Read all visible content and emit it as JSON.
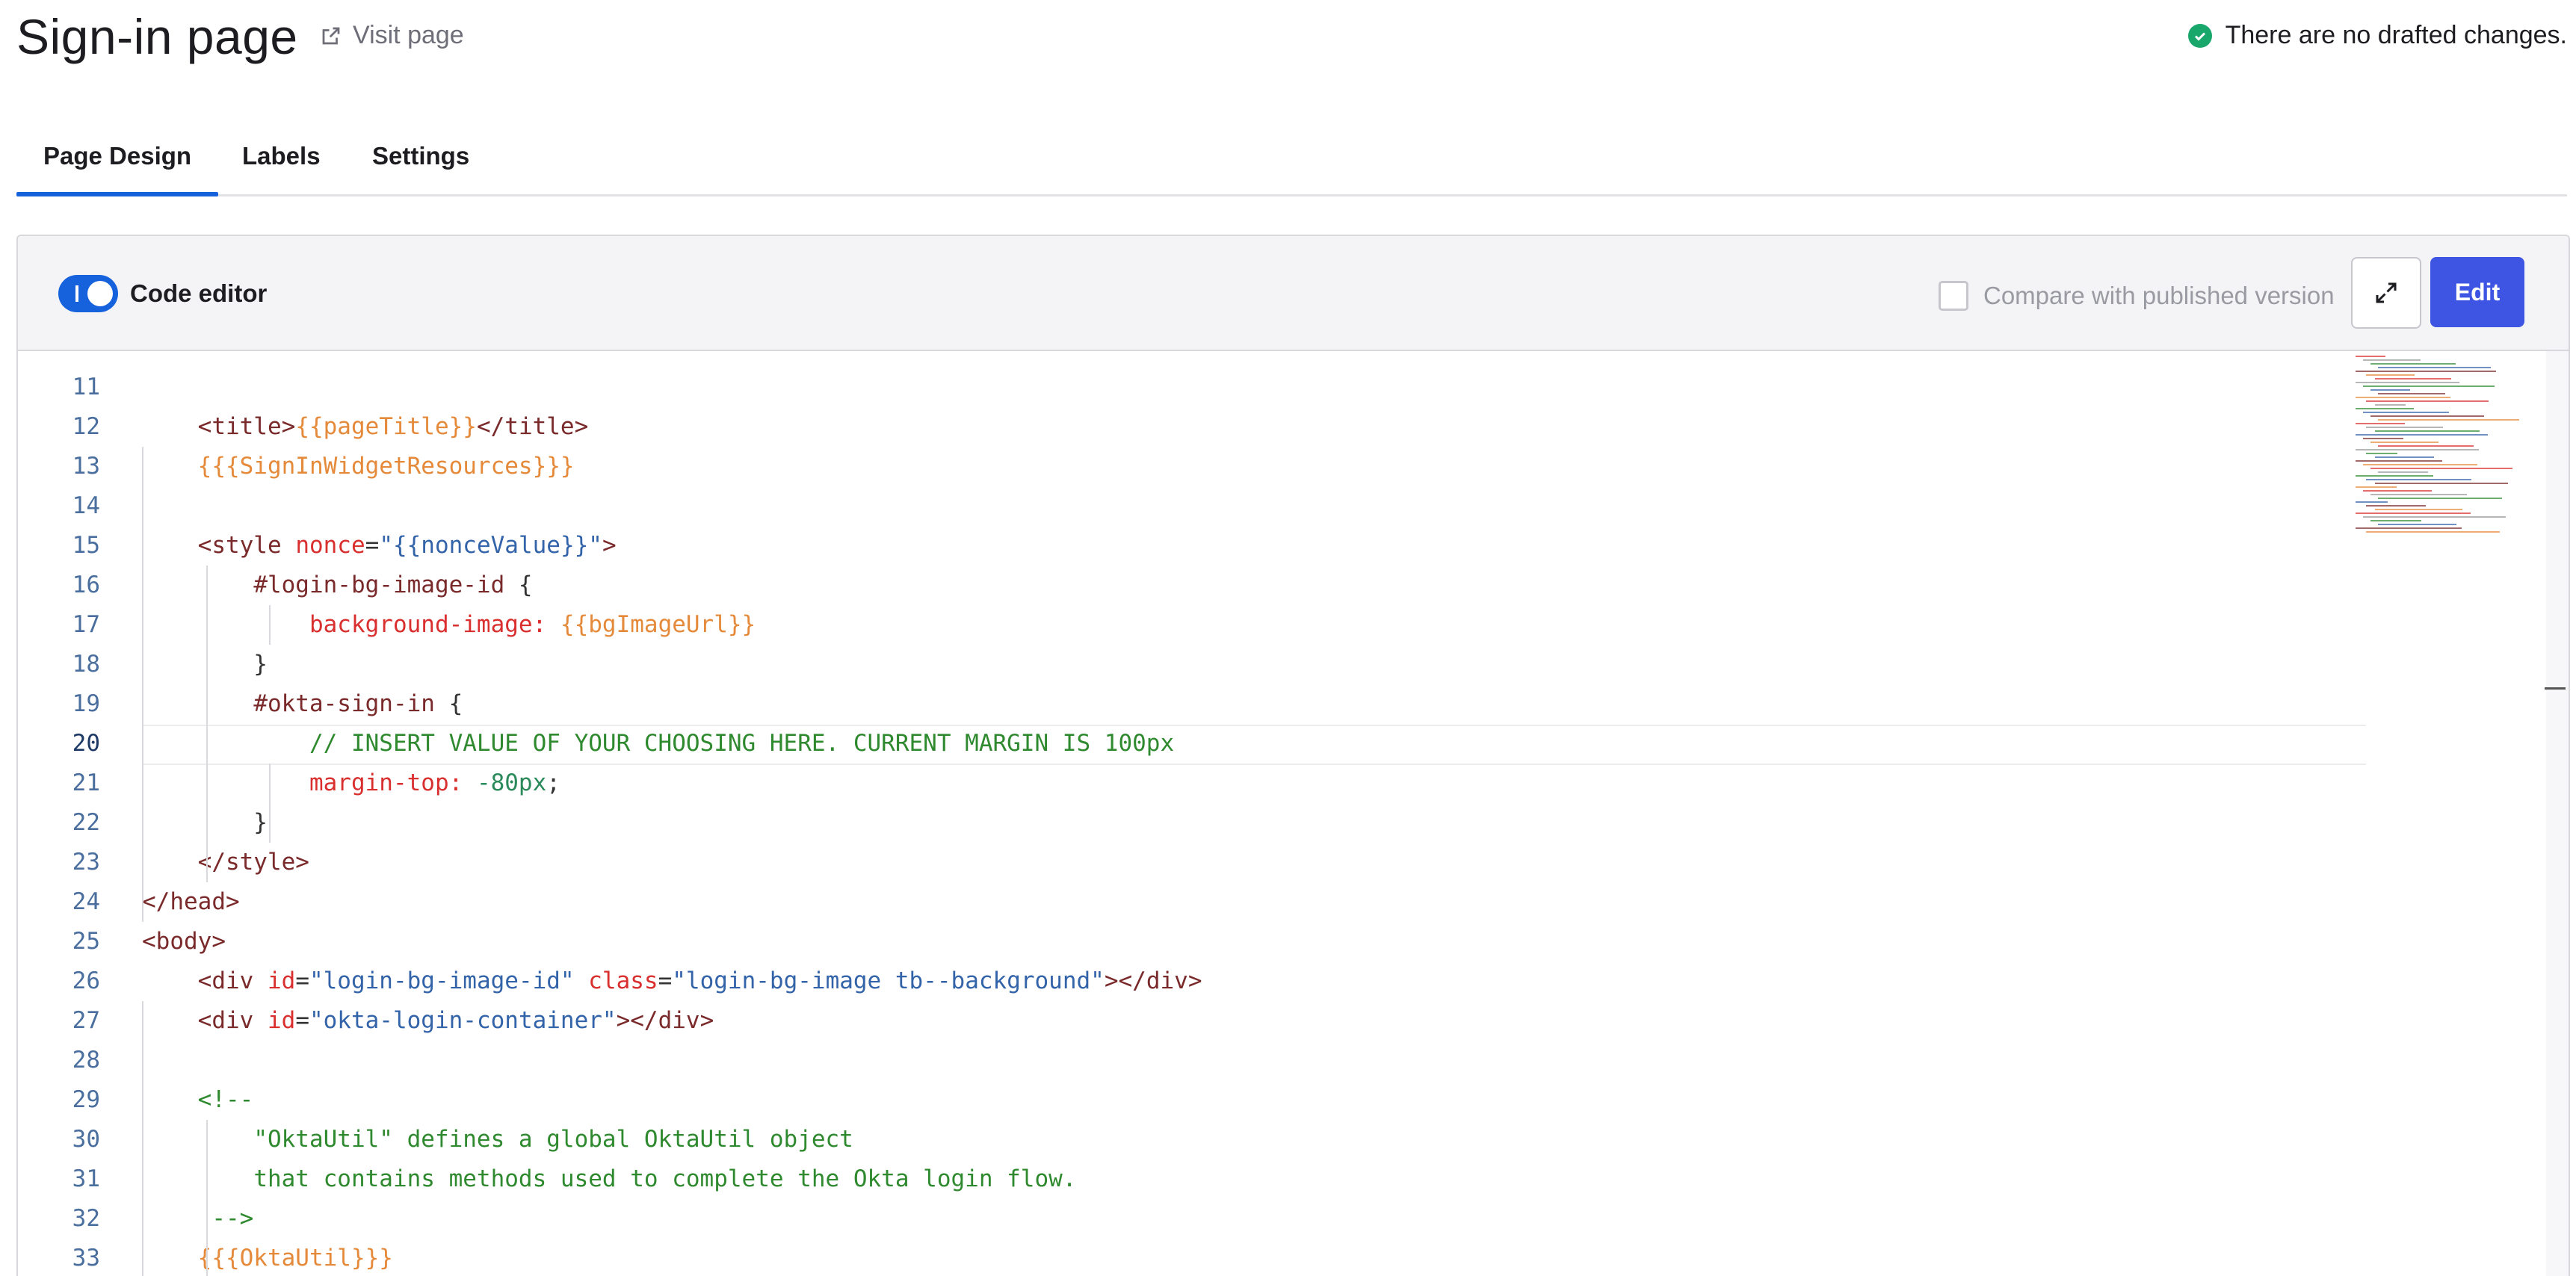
{
  "header": {
    "title": "Sign-in page",
    "visit_link": "Visit page",
    "status_text": "There are no drafted changes.",
    "status_color": "#1aa76b"
  },
  "tabs": [
    {
      "label": "Page Design",
      "active": true
    },
    {
      "label": "Labels",
      "active": false
    },
    {
      "label": "Settings",
      "active": false
    }
  ],
  "toolbar": {
    "toggle_label": "Code editor",
    "toggle_on": true,
    "compare_label": "Compare with published version",
    "compare_checked": false,
    "edit_label": "Edit",
    "expand_icon": "expand-icon"
  },
  "colors": {
    "accent": "#1662dd",
    "edit_button": "#3e55e3"
  },
  "code": {
    "current_line": 20,
    "lines": [
      {
        "n": 11,
        "tokens": []
      },
      {
        "n": 12,
        "tokens": [
          [
            "t-pun",
            "    "
          ],
          [
            "t-tag",
            "<title>"
          ],
          [
            "t-tpl",
            "{{pageTitle}}"
          ],
          [
            "t-tag",
            "</title>"
          ]
        ]
      },
      {
        "n": 13,
        "tokens": [
          [
            "t-pun",
            "    "
          ],
          [
            "t-tpl",
            "{{{SignInWidgetResources}}}"
          ]
        ]
      },
      {
        "n": 14,
        "tokens": []
      },
      {
        "n": 15,
        "tokens": [
          [
            "t-pun",
            "    "
          ],
          [
            "t-tag",
            "<style "
          ],
          [
            "t-attr",
            "nonce"
          ],
          [
            "t-pun",
            "="
          ],
          [
            "t-str",
            "\"{{nonceValue}}\""
          ],
          [
            "t-tag",
            ">"
          ]
        ]
      },
      {
        "n": 16,
        "tokens": [
          [
            "t-pun",
            "        "
          ],
          [
            "t-sel",
            "#login-bg-image-id "
          ],
          [
            "t-pun",
            "{"
          ]
        ]
      },
      {
        "n": 17,
        "tokens": [
          [
            "t-pun",
            "            "
          ],
          [
            "t-attr",
            "background-image: "
          ],
          [
            "t-tpl",
            "{{bgImageUrl}}"
          ]
        ]
      },
      {
        "n": 18,
        "tokens": [
          [
            "t-pun",
            "        }"
          ]
        ]
      },
      {
        "n": 19,
        "tokens": [
          [
            "t-pun",
            "        "
          ],
          [
            "t-sel",
            "#okta-sign-in "
          ],
          [
            "t-pun",
            "{"
          ]
        ]
      },
      {
        "n": 20,
        "tokens": [
          [
            "t-pun",
            "            "
          ],
          [
            "t-cmt",
            "// INSERT VALUE OF YOUR CHOOSING HERE. CURRENT MARGIN IS 100px"
          ]
        ]
      },
      {
        "n": 21,
        "tokens": [
          [
            "t-pun",
            "            "
          ],
          [
            "t-attr",
            "margin-top: "
          ],
          [
            "t-num",
            "-80px"
          ],
          [
            "t-pun",
            ";"
          ]
        ]
      },
      {
        "n": 22,
        "tokens": [
          [
            "t-pun",
            "        }"
          ]
        ]
      },
      {
        "n": 23,
        "tokens": [
          [
            "t-pun",
            "    "
          ],
          [
            "t-tag",
            "</style>"
          ]
        ]
      },
      {
        "n": 24,
        "tokens": [
          [
            "t-tag",
            "</head>"
          ]
        ]
      },
      {
        "n": 25,
        "tokens": [
          [
            "t-tag",
            "<body>"
          ]
        ]
      },
      {
        "n": 26,
        "tokens": [
          [
            "t-pun",
            "    "
          ],
          [
            "t-tag",
            "<div "
          ],
          [
            "t-attr",
            "id"
          ],
          [
            "t-pun",
            "="
          ],
          [
            "t-str",
            "\"login-bg-image-id\" "
          ],
          [
            "t-attr",
            "class"
          ],
          [
            "t-pun",
            "="
          ],
          [
            "t-str",
            "\"login-bg-image tb--background\""
          ],
          [
            "t-tag",
            "></div>"
          ]
        ]
      },
      {
        "n": 27,
        "tokens": [
          [
            "t-pun",
            "    "
          ],
          [
            "t-tag",
            "<div "
          ],
          [
            "t-attr",
            "id"
          ],
          [
            "t-pun",
            "="
          ],
          [
            "t-str",
            "\"okta-login-container\""
          ],
          [
            "t-tag",
            "></div>"
          ]
        ]
      },
      {
        "n": 28,
        "tokens": []
      },
      {
        "n": 29,
        "tokens": [
          [
            "t-pun",
            "    "
          ],
          [
            "t-cmt",
            "<!--"
          ]
        ]
      },
      {
        "n": 30,
        "tokens": [
          [
            "t-pun",
            "        "
          ],
          [
            "t-cmt",
            "\"OktaUtil\" defines a global OktaUtil object"
          ]
        ]
      },
      {
        "n": 31,
        "tokens": [
          [
            "t-pun",
            "        "
          ],
          [
            "t-cmt",
            "that contains methods used to complete the Okta login flow."
          ]
        ]
      },
      {
        "n": 32,
        "tokens": [
          [
            "t-pun",
            "     "
          ],
          [
            "t-cmt",
            "-->"
          ]
        ]
      },
      {
        "n": 33,
        "tokens": [
          [
            "t-pun",
            "    "
          ],
          [
            "t-tpl",
            "{{{OktaUtil}}}"
          ]
        ]
      }
    ]
  }
}
